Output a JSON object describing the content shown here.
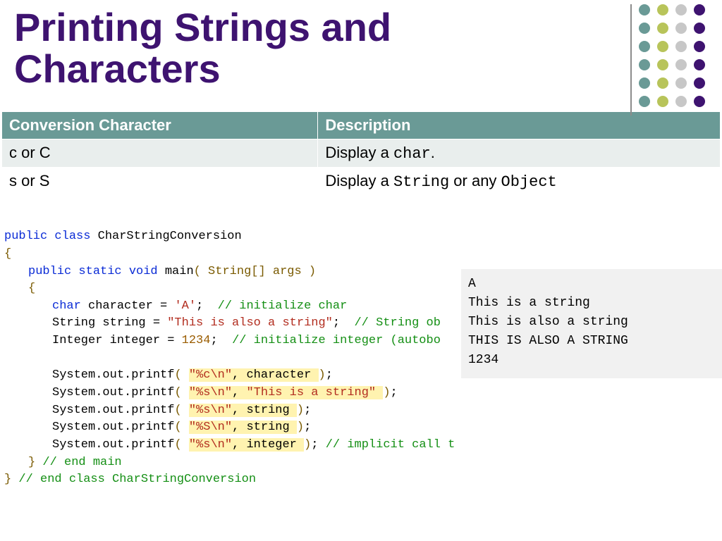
{
  "title": "Printing Strings and Characters",
  "dots": {
    "colors": [
      "#6a9a96",
      "#b8c45a",
      "#c7c7c7",
      "#3e1370"
    ],
    "rows": 6,
    "cols": 4
  },
  "table": {
    "headers": [
      "Conversion Character",
      "Description"
    ],
    "rows": [
      {
        "spec": "c or C",
        "desc_pre": "Display a ",
        "desc_code": "char",
        "desc_post": "."
      },
      {
        "spec": "s or S",
        "desc_pre": "Display a ",
        "desc_code": "String",
        "desc_mid": " or any ",
        "desc_code2": "Object",
        "desc_post": ""
      }
    ]
  },
  "code": {
    "class_kw": "public class",
    "class_name": " CharStringConversion",
    "open": "{",
    "main_sig_kw1": "public static void",
    "main_sig_name": " main",
    "main_sig_paren": "( String",
    "main_sig_arr": "[] args )",
    "open2": "{",
    "l_char_kw": "char",
    "l_char_rest": " character = ",
    "l_char_val": "'A'",
    "l_char_cmt": "// initialize char",
    "l_str_decl": "String string = ",
    "l_str_val": "\"This is also a string\"",
    "l_str_cmt": "// String ob",
    "l_int_decl": "Integer integer = ",
    "l_int_val": "1234",
    "l_int_cmt": "// initialize integer (autobo",
    "p_pre": "System.out.printf",
    "p1_fmt": "\"%c\\n\"",
    "p1_arg": "character",
    "p2_fmt": "\"%s\\n\"",
    "p2_arg": "\"This is a string\"",
    "p3_fmt": "\"%s\\n\"",
    "p3_arg": "string",
    "p4_fmt": "\"%S\\n\"",
    "p4_arg": "string",
    "p5_fmt": "\"%s\\n\"",
    "p5_arg": "integer",
    "p5_cmt": "// implicit call to toString",
    "close_main": "} ",
    "close_main_cmt": "// end main",
    "close_cls": "} ",
    "close_cls_cmt": "// end class CharStringConversion"
  },
  "console": "A\nThis is a string\nThis is also a string\nTHIS IS ALSO A STRING\n1234"
}
